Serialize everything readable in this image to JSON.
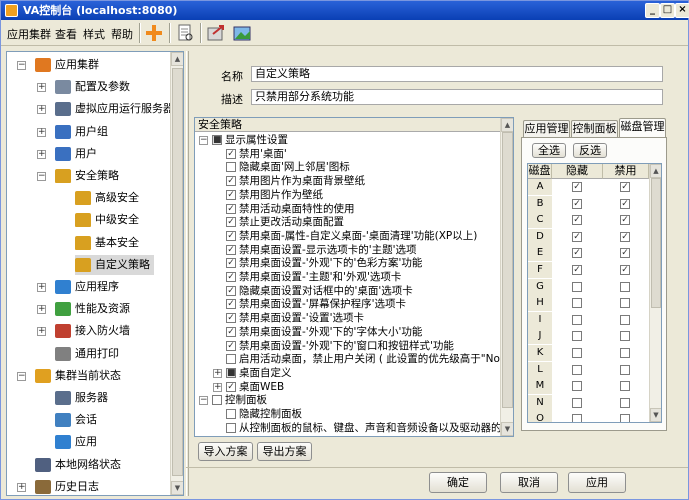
{
  "window": {
    "title": "VA控制台 (localhost:8080)",
    "controls": [
      "_",
      "□",
      "×"
    ]
  },
  "menu": [
    "应用集群",
    "查看",
    "样式",
    "帮助"
  ],
  "toolbar": {
    "icons": [
      "add-icon",
      "document-icon",
      "export-icon",
      "image-icon"
    ]
  },
  "tree": {
    "nodes": [
      {
        "label": "应用集群",
        "level": 0,
        "icon": "cluster-icon",
        "expander": "−"
      },
      {
        "label": "配置及参数",
        "level": 1,
        "icon": "gear-icon",
        "expander": "+"
      },
      {
        "label": "虚拟应用运行服务器",
        "level": 1,
        "icon": "server-icon",
        "expander": "+"
      },
      {
        "label": "用户组",
        "level": 1,
        "icon": "users-icon",
        "expander": "+"
      },
      {
        "label": "用户",
        "level": 1,
        "icon": "user-icon",
        "expander": "+"
      },
      {
        "label": "安全策略",
        "level": 1,
        "icon": "lock-icon",
        "expander": "−"
      },
      {
        "label": "高级安全",
        "level": 2,
        "icon": "lock-icon",
        "expander": ""
      },
      {
        "label": "中级安全",
        "level": 2,
        "icon": "lock-icon",
        "expander": ""
      },
      {
        "label": "基本安全",
        "level": 2,
        "icon": "lock-icon",
        "expander": ""
      },
      {
        "label": "自定义策略",
        "level": 2,
        "icon": "lock-icon",
        "expander": "",
        "selected": true
      },
      {
        "label": "应用程序",
        "level": 1,
        "icon": "app-icon",
        "expander": "+"
      },
      {
        "label": "性能及资源",
        "level": 1,
        "icon": "chart-icon",
        "expander": "+"
      },
      {
        "label": "接入防火墙",
        "level": 1,
        "icon": "firewall-icon",
        "expander": "+"
      },
      {
        "label": "通用打印",
        "level": 1,
        "icon": "printer-icon",
        "expander": ""
      },
      {
        "label": "集群当前状态",
        "level": 0,
        "icon": "status-icon",
        "expander": "−"
      },
      {
        "label": "服务器",
        "level": 1,
        "icon": "server-icon",
        "expander": ""
      },
      {
        "label": "会话",
        "level": 1,
        "icon": "session-icon",
        "expander": ""
      },
      {
        "label": "应用",
        "level": 1,
        "icon": "app-icon",
        "expander": ""
      },
      {
        "label": "本地网络状态",
        "level": 0,
        "icon": "network-icon",
        "expander": ""
      },
      {
        "label": "历史日志",
        "level": 0,
        "icon": "log-icon",
        "expander": "+"
      }
    ]
  },
  "form": {
    "name_label": "名称",
    "name_value": "自定义策略",
    "desc_label": "描述",
    "desc_value": "只禁用部分系统功能"
  },
  "policy": {
    "header": "安全策略",
    "rows": [
      {
        "text": "显示属性设置",
        "indent": 1,
        "state": "partial",
        "exp": "−"
      },
      {
        "text": "禁用'桌面'",
        "indent": 2,
        "state": "checked"
      },
      {
        "text": "隐藏桌面'网上邻居'图标",
        "indent": 2,
        "state": "unchecked"
      },
      {
        "text": "禁用图片作为桌面背景壁纸",
        "indent": 2,
        "state": "checked"
      },
      {
        "text": "禁用图片作为壁纸",
        "indent": 2,
        "state": "checked"
      },
      {
        "text": "禁用活动桌面特性的使用",
        "indent": 2,
        "state": "checked"
      },
      {
        "text": "禁止更改活动桌面配置",
        "indent": 2,
        "state": "checked"
      },
      {
        "text": "禁用桌面-属性-自定义桌面-'桌面清理'功能(XP以上)",
        "indent": 2,
        "state": "checked"
      },
      {
        "text": "禁用桌面设置-显示选项卡的'主题'选项",
        "indent": 2,
        "state": "checked"
      },
      {
        "text": "禁用桌面设置-'外观'下的'色彩方案'功能",
        "indent": 2,
        "state": "checked"
      },
      {
        "text": "禁用桌面设置-'主题'和'外观'选项卡",
        "indent": 2,
        "state": "checked"
      },
      {
        "text": "隐藏桌面设置对话框中的'桌面'选项卡",
        "indent": 2,
        "state": "checked"
      },
      {
        "text": "禁用桌面设置-'屏幕保护程序'选项卡",
        "indent": 2,
        "state": "checked"
      },
      {
        "text": "禁用桌面设置-'设置'选项卡",
        "indent": 2,
        "state": "checked"
      },
      {
        "text": "禁用桌面设置-'外观'下的'字体大小'功能",
        "indent": 2,
        "state": "checked"
      },
      {
        "text": "禁用桌面设置-'外观'下的'窗口和按钮样式'功能",
        "indent": 2,
        "state": "checked"
      },
      {
        "text": "启用活动桌面，禁止用户关闭 ( 此设置的优先级高于\"NoA…",
        "indent": 2,
        "state": "unchecked"
      },
      {
        "text": "桌面自定义",
        "indent": 2,
        "state": "partial",
        "exp": "+"
      },
      {
        "text": "桌面WEB",
        "indent": 2,
        "state": "checked",
        "exp": "+"
      },
      {
        "text": "控制面板",
        "indent": 1,
        "state": "unchecked",
        "exp": "−"
      },
      {
        "text": "隐藏控制面板",
        "indent": 2,
        "state": "unchecked"
      },
      {
        "text": "从控制面板的鼠标、键盘、声音和音频设备以及驱动器的",
        "indent": 2,
        "state": "unchecked"
      }
    ]
  },
  "buttons": {
    "import": "导入方案",
    "export": "导出方案",
    "ok": "确定",
    "cancel": "取消",
    "apply": "应用",
    "select_all": "全选",
    "invert": "反选"
  },
  "tabs": [
    "应用管理",
    "控制面板",
    "磁盘管理"
  ],
  "disk": {
    "headers": [
      "磁盘",
      "隐藏",
      "禁用"
    ],
    "rows": [
      {
        "letter": "A",
        "hide": true,
        "disable": true
      },
      {
        "letter": "B",
        "hide": true,
        "disable": true
      },
      {
        "letter": "C",
        "hide": true,
        "disable": true
      },
      {
        "letter": "D",
        "hide": true,
        "disable": true
      },
      {
        "letter": "E",
        "hide": true,
        "disable": true
      },
      {
        "letter": "F",
        "hide": true,
        "disable": true
      },
      {
        "letter": "G",
        "hide": false,
        "disable": false
      },
      {
        "letter": "H",
        "hide": false,
        "disable": false
      },
      {
        "letter": "I",
        "hide": false,
        "disable": false
      },
      {
        "letter": "J",
        "hide": false,
        "disable": false
      },
      {
        "letter": "K",
        "hide": false,
        "disable": false
      },
      {
        "letter": "L",
        "hide": false,
        "disable": false
      },
      {
        "letter": "M",
        "hide": false,
        "disable": false
      },
      {
        "letter": "N",
        "hide": false,
        "disable": false
      },
      {
        "letter": "O",
        "hide": false,
        "disable": false
      }
    ]
  }
}
